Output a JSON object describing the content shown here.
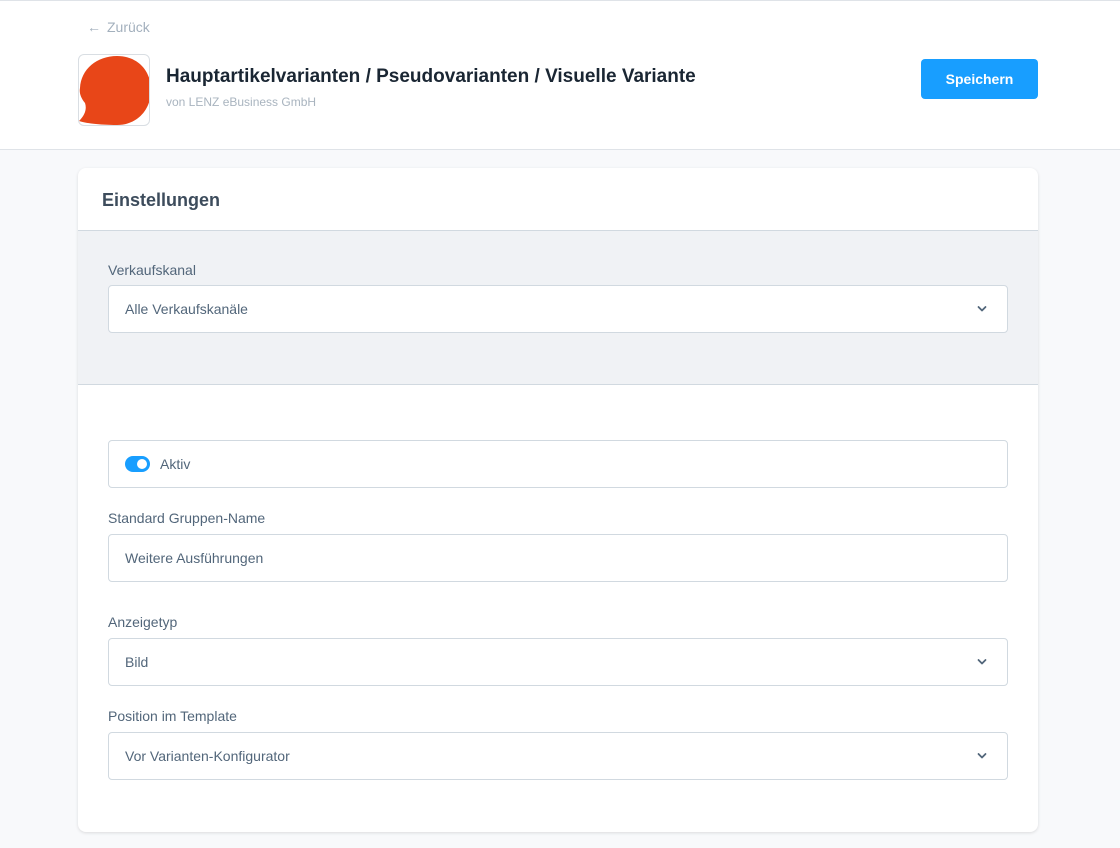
{
  "header": {
    "back_label": "Zurück",
    "title": "Hauptartikelvarianten / Pseudovarianten / Visuelle Variante",
    "subtitle": "von LENZ eBusiness GmbH",
    "save_label": "Speichern"
  },
  "card": {
    "title": "Einstellungen",
    "sales_channel": {
      "label": "Verkaufskanal",
      "value": "Alle Verkaufskanäle"
    },
    "active": {
      "label": "Aktiv",
      "checked": true
    },
    "group_name": {
      "label": "Standard Gruppen-Name",
      "value": "Weitere Ausführungen"
    },
    "display_type": {
      "label": "Anzeigetyp",
      "value": "Bild"
    },
    "template_position": {
      "label": "Position im Template",
      "value": "Vor Varianten-Konfigurator"
    }
  },
  "colors": {
    "accent": "#189eff",
    "logo": "#e84618"
  },
  "icons": [
    "arrow-left-icon",
    "app-logo-icon",
    "chevron-down-icon"
  ]
}
